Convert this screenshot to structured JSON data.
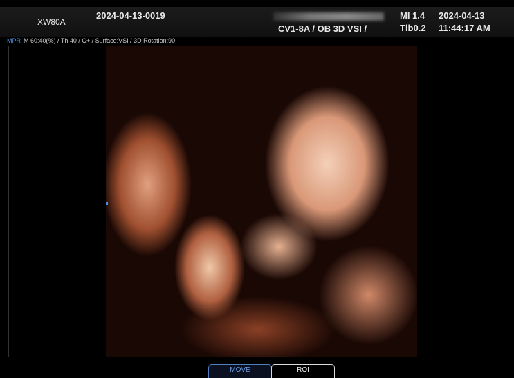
{
  "header": {
    "model": "XW80A",
    "patient_id": "2024-04-13-0019",
    "probe_preset": "CV1-8A / OB 3D VSI /",
    "mi": "MI  1.4",
    "tib": "Tlb0.2",
    "date": "2024-04-13",
    "time": "11:44:17 AM"
  },
  "info": {
    "mpr_label": "MPR",
    "params": "M 60:40(%) / Th 40 / C+ / Surface:VSI / 3D Rotation:90"
  },
  "buttons": {
    "move": "MOVE",
    "roi": "ROI"
  }
}
